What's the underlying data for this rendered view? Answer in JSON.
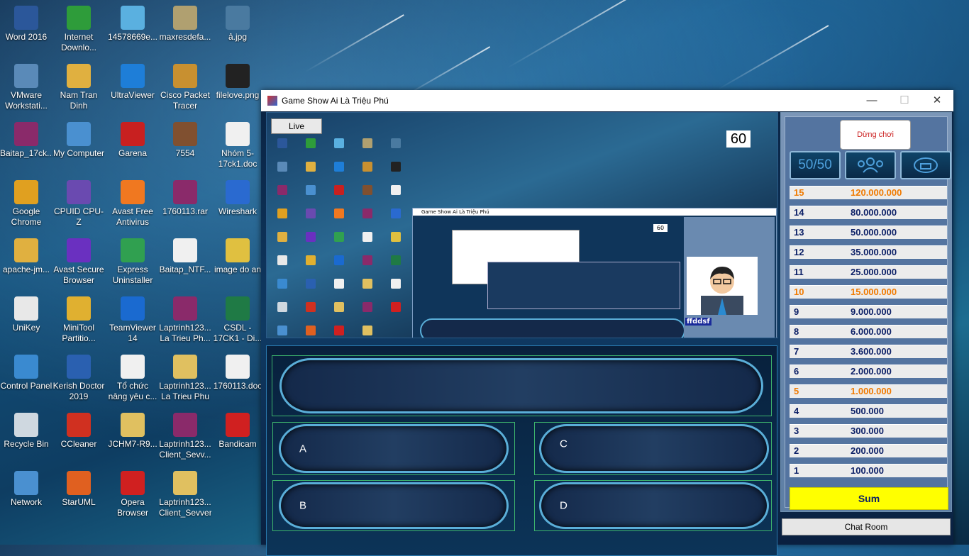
{
  "desktop": {
    "icons": [
      {
        "label": "Word 2016",
        "color": "#2b579a"
      },
      {
        "label": "Internet Downlo...",
        "color": "#2e9c3a"
      },
      {
        "label": "14578669e...",
        "color": "#5ab0e0"
      },
      {
        "label": "maxresdefa...",
        "color": "#b0a070"
      },
      {
        "label": "ả.jpg",
        "color": "#4a7aa0"
      },
      {
        "label": "VMware Workstati...",
        "color": "#5a8ab8"
      },
      {
        "label": "Nam Tran Dinh",
        "color": "#e0b040"
      },
      {
        "label": "UltraViewer",
        "color": "#1e7ed8"
      },
      {
        "label": "Cisco Packet Tracer",
        "color": "#c89030"
      },
      {
        "label": "filelove.png",
        "color": "#222222"
      },
      {
        "label": "Baitap_17ck...",
        "color": "#8a2a6a"
      },
      {
        "label": "My Computer",
        "color": "#4a90d0"
      },
      {
        "label": "Garena",
        "color": "#c82020"
      },
      {
        "label": "7554",
        "color": "#805030"
      },
      {
        "label": "Nhóm 5-17ck1.doc",
        "color": "#f0f0f0"
      },
      {
        "label": "Google Chrome",
        "color": "#e0a020"
      },
      {
        "label": "CPUID CPU-Z",
        "color": "#6a4ab0"
      },
      {
        "label": "Avast Free Antivirus",
        "color": "#f07820"
      },
      {
        "label": "1760113.rar",
        "color": "#8a2a6a"
      },
      {
        "label": "Wireshark",
        "color": "#2a6ad0"
      },
      {
        "label": "apache-jm...",
        "color": "#e0b040"
      },
      {
        "label": "Avast Secure Browser",
        "color": "#6a30c0"
      },
      {
        "label": "Express Uninstaller",
        "color": "#30a050"
      },
      {
        "label": "Baitap_NTF...",
        "color": "#f0f0f0"
      },
      {
        "label": "image do an",
        "color": "#e0c040"
      },
      {
        "label": "UniKey",
        "color": "#e8e8e8"
      },
      {
        "label": "MiniTool Partitio...",
        "color": "#e0b030"
      },
      {
        "label": "TeamViewer 14",
        "color": "#1a6ad0"
      },
      {
        "label": "Laptrinh123... La Trieu Ph...",
        "color": "#8a2a6a"
      },
      {
        "label": "CSDL - 17CK1 - Di...",
        "color": "#1f7a45"
      },
      {
        "label": "Control Panel",
        "color": "#3a8ad0"
      },
      {
        "label": "Kerish Doctor 2019",
        "color": "#2a60b0"
      },
      {
        "label": "Tổ chức nâng yêu c...",
        "color": "#f0f0f0"
      },
      {
        "label": "Laptrinh123... La Trieu Phu",
        "color": "#e0c060"
      },
      {
        "label": "1760113.doc",
        "color": "#f0f0f0"
      },
      {
        "label": "Recycle Bin",
        "color": "#cfd8e0"
      },
      {
        "label": "CCleaner",
        "color": "#d03020"
      },
      {
        "label": "JCHM7-R9...",
        "color": "#e0c060"
      },
      {
        "label": "Laptrinh123... Client_Sevv...",
        "color": "#8a2a6a"
      },
      {
        "label": "Bandicam",
        "color": "#d02020"
      },
      {
        "label": "Network",
        "color": "#4a90d0"
      },
      {
        "label": "StarUML",
        "color": "#e06020"
      },
      {
        "label": "Opera Browser",
        "color": "#d02020"
      },
      {
        "label": "Laptrinh123... Client_Sevver",
        "color": "#e0c060"
      }
    ]
  },
  "window": {
    "title": "Game Show Ai Là Triệu Phú",
    "minimize": "—",
    "maximize": "☐",
    "close": "✕"
  },
  "game": {
    "live_label": "Live",
    "timer": "60",
    "nested_title": "Game Show Ai Là Triệu Phú",
    "nested_timer": "60",
    "nested_name": "ffddsf",
    "question": "",
    "answers": [
      {
        "letter": "A",
        "text": ""
      },
      {
        "letter": "C",
        "text": ""
      },
      {
        "letter": "B",
        "text": ""
      },
      {
        "letter": "D",
        "text": ""
      }
    ]
  },
  "sidebar": {
    "stop_label": "Dừng chơi",
    "fifty_label": "50/50",
    "audience_icon": "audience-icon",
    "phone_icon": "phone-icon",
    "prizes": [
      {
        "level": "15",
        "amount": "120.000.000",
        "milestone": true
      },
      {
        "level": "14",
        "amount": "80.000.000",
        "milestone": false
      },
      {
        "level": "13",
        "amount": "50.000.000",
        "milestone": false
      },
      {
        "level": "12",
        "amount": "35.000.000",
        "milestone": false
      },
      {
        "level": "11",
        "amount": "25.000.000",
        "milestone": false
      },
      {
        "level": "10",
        "amount": "15.000.000",
        "milestone": true
      },
      {
        "level": "9",
        "amount": "9.000.000",
        "milestone": false
      },
      {
        "level": "8",
        "amount": "6.000.000",
        "milestone": false
      },
      {
        "level": "7",
        "amount": "3.600.000",
        "milestone": false
      },
      {
        "level": "6",
        "amount": "2.000.000",
        "milestone": false
      },
      {
        "level": "5",
        "amount": "1.000.000",
        "milestone": true
      },
      {
        "level": "4",
        "amount": "500.000",
        "milestone": false
      },
      {
        "level": "3",
        "amount": "300.000",
        "milestone": false
      },
      {
        "level": "2",
        "amount": "200.000",
        "milestone": false
      },
      {
        "level": "1",
        "amount": "100.000",
        "milestone": false
      }
    ],
    "sum_label": "Sum",
    "chat_label": "Chat Room"
  },
  "colors": {
    "milestone": "#f07a00",
    "amount": "#0b1f66",
    "sum_bg": "#ffff00",
    "answer_border": "#3db46d"
  }
}
